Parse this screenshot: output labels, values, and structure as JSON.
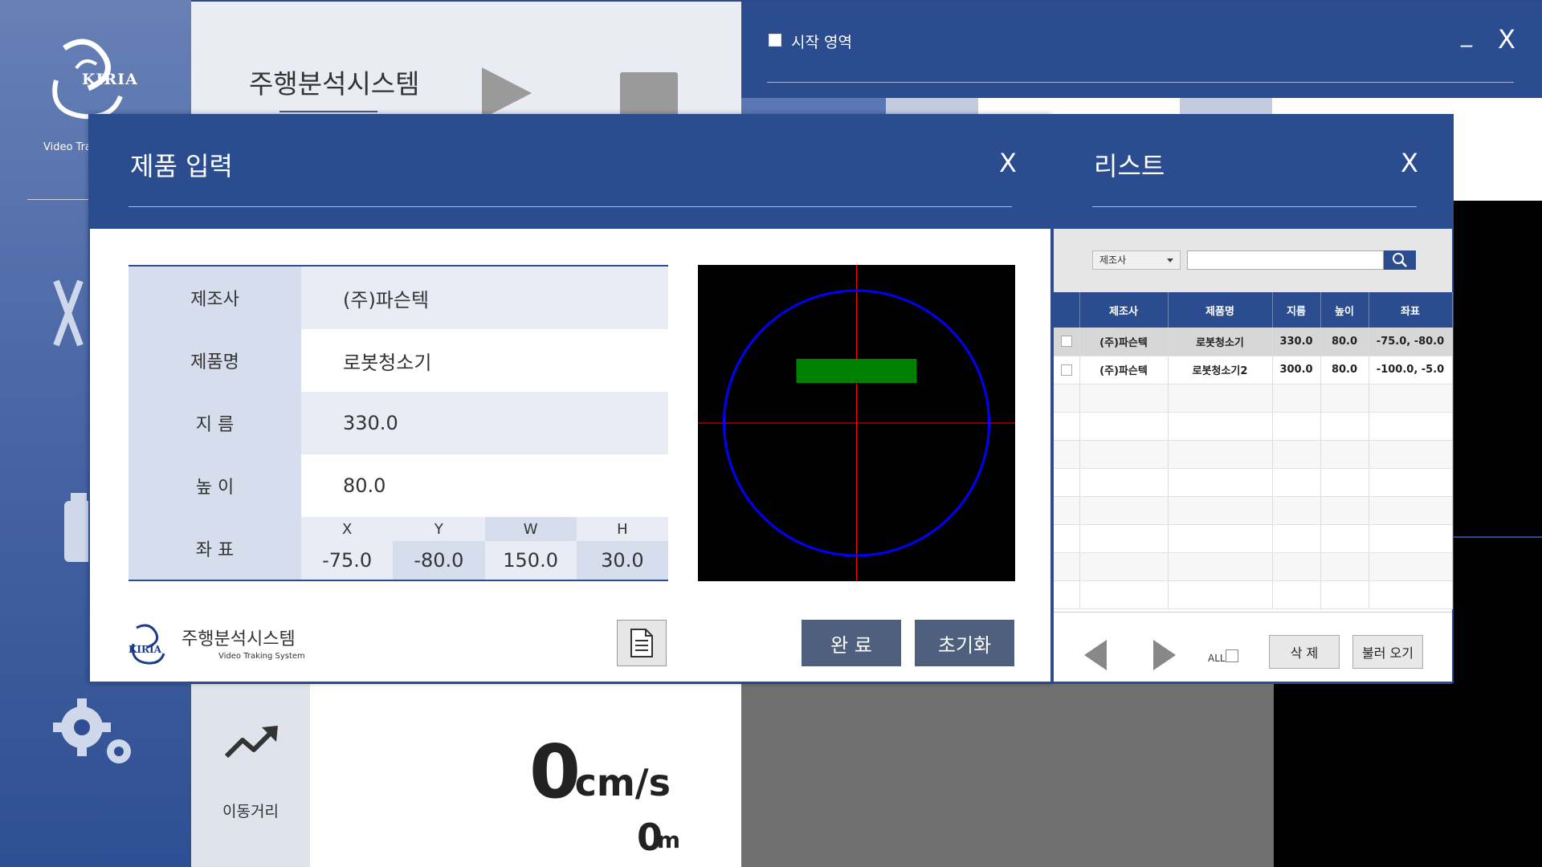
{
  "sidebar": {
    "brand": "KIRIA",
    "caption": "Video Tra"
  },
  "header": {
    "app_title": "주행분석시스템"
  },
  "start_window": {
    "label": "시작 영역",
    "minimize": "_",
    "close": "X"
  },
  "metrics": {
    "distance_label": "이동거리",
    "speed_value": "0",
    "speed_unit": "cm/s",
    "distance_value": "0",
    "distance_unit": "m"
  },
  "product_dialog": {
    "title": "제품 입력",
    "close": "X",
    "fields": [
      {
        "label": "제조사",
        "value": "(주)파슨텍"
      },
      {
        "label": "제품명",
        "value": "로봇청소기"
      },
      {
        "label": "지 름",
        "value": "330.0"
      },
      {
        "label": "높 이",
        "value": "80.0"
      }
    ],
    "coords": {
      "label": "좌 표",
      "headers": [
        "X",
        "Y",
        "W",
        "H"
      ],
      "values": [
        "-75.0",
        "-80.0",
        "150.0",
        "30.0"
      ]
    },
    "footer": {
      "brand": "KIRIA",
      "title": "주행분석시스템",
      "subtitle": "Video Traking System"
    },
    "buttons": {
      "complete": "완  료",
      "reset": "초기화"
    },
    "preview_colors": {
      "circle": "#0000ff",
      "rect": "#008000",
      "crosshair": "#ff0000"
    }
  },
  "list_dialog": {
    "title": "리스트",
    "close": "X",
    "filter": {
      "selected": "제조사"
    },
    "columns": [
      "제조사",
      "제품명",
      "지름",
      "높이",
      "좌표"
    ],
    "rows": [
      {
        "maker": "(주)파슨텍",
        "product": "로봇청소기",
        "diameter": "330.0",
        "height": "80.0",
        "coord": "-75.0, -80.0"
      },
      {
        "maker": "(주)파슨텍",
        "product": "로봇청소기2",
        "diameter": "300.0",
        "height": "80.0",
        "coord": "-100.0, -5.0"
      }
    ],
    "footer": {
      "all_label": "ALL",
      "delete": "삭 제",
      "load": "불러 오기"
    }
  },
  "colors": {
    "primary": "#2b4d90",
    "button_dark": "#4f607e"
  }
}
